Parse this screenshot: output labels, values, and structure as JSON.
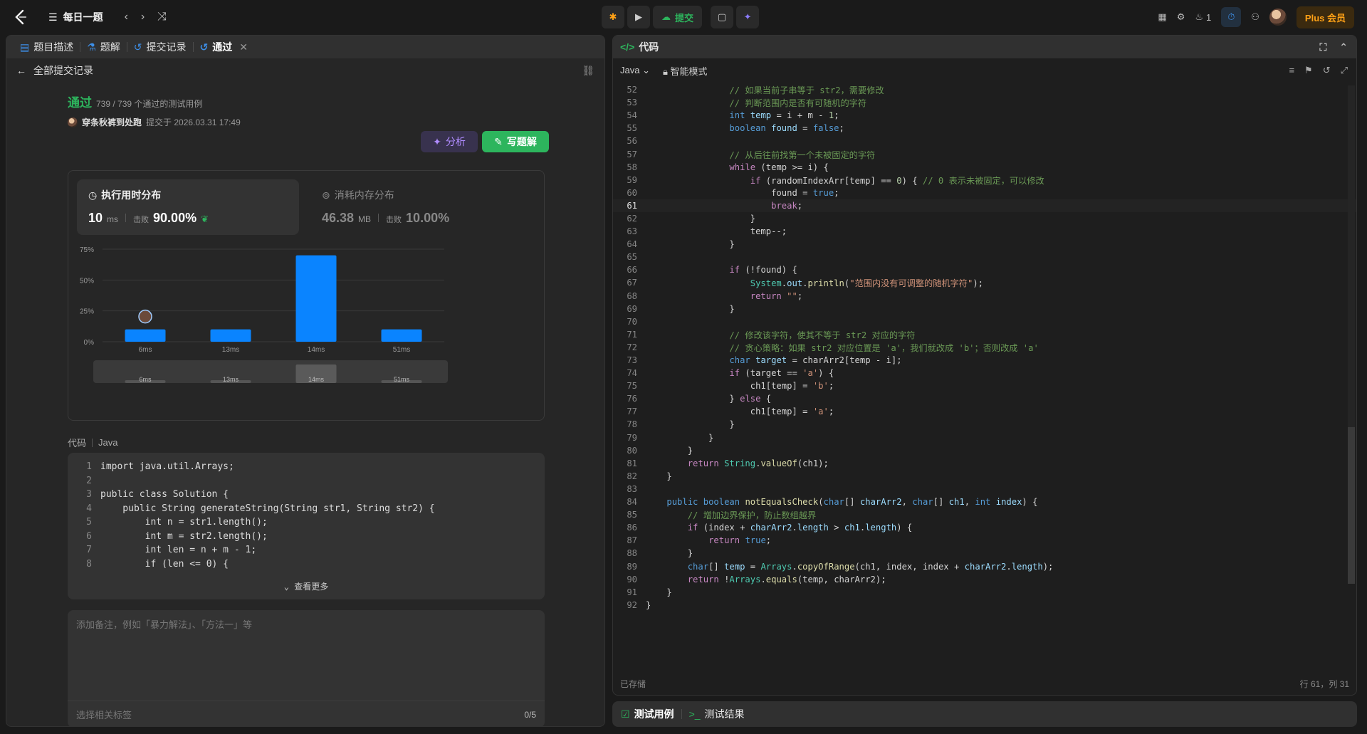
{
  "topbar": {
    "title": "每日一题",
    "submit_label": "提交",
    "fire_count": "1",
    "plus_label": "Plus 会员"
  },
  "left": {
    "tabs": [
      {
        "label": "题目描述"
      },
      {
        "label": "题解"
      },
      {
        "label": "提交记录"
      },
      {
        "label": "通过"
      }
    ],
    "back_label": "全部提交记录",
    "status": "通过",
    "passed_cases": "739 / 739 个通过的测试用例",
    "author": "穿条秋裤到处跑",
    "submitted_at": "提交于 2026.03.31 17:49",
    "analyze_label": "分析",
    "write_label": "写题解",
    "runtime": {
      "title": "执行用时分布",
      "value": "10",
      "unit": "ms",
      "beat_label": "击败",
      "beat": "90.00%"
    },
    "memory": {
      "title": "消耗内存分布",
      "value": "46.38",
      "unit": "MB",
      "beat_label": "击败",
      "beat": "10.00%"
    },
    "code_label": "代码",
    "code_lang": "Java",
    "code_lines": [
      "import java.util.Arrays;",
      "",
      "public class Solution {",
      "    public String generateString(String str1, String str2) {",
      "        int n = str1.length();",
      "        int m = str2.length();",
      "        int len = n + m - 1;",
      "        if (len <= 0) {"
    ],
    "view_more": "查看更多",
    "note_placeholder": "添加备注，例如「暴力解法」、「方法一」等",
    "tag_placeholder": "选择相关标签",
    "tag_count": "0/5",
    "color_dots": [
      "#8a8a8a",
      "#f5b400",
      "#2d7ff9",
      "#2db55d",
      "#e54b8a",
      "#b44be5"
    ]
  },
  "chart_data": {
    "type": "bar",
    "categories": [
      "6ms",
      "13ms",
      "14ms",
      "51ms"
    ],
    "values": [
      10,
      10,
      70,
      10
    ],
    "ylim": [
      0,
      75
    ],
    "yticks": [
      "0%",
      "25%",
      "50%",
      "75%"
    ],
    "highlight_category": "6ms",
    "bar_color": "#0a84ff",
    "grid": true
  },
  "right": {
    "title": "代码",
    "lang": "Java",
    "mode": "智能模式",
    "saved": "已存储",
    "cursor": "行 61，列 31",
    "bottom_tabs": [
      {
        "label": "测试用例"
      },
      {
        "label": "测试结果"
      }
    ]
  }
}
